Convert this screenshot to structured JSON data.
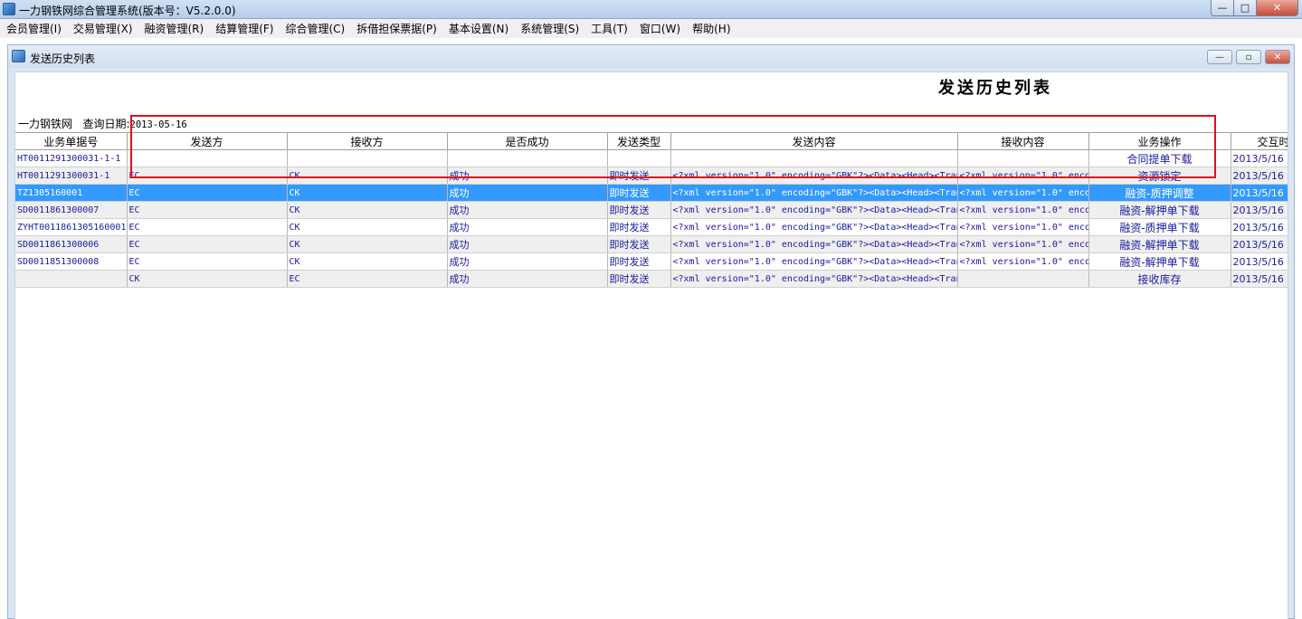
{
  "app": {
    "title": "一力钢铁网综合管理系统(版本号：V5.2.0.0)",
    "window_buttons": {
      "minimize": "—",
      "maximize": "□",
      "close": "✕"
    }
  },
  "menu": [
    "会员管理(I)",
    "交易管理(X)",
    "融资管理(R)",
    "结算管理(F)",
    "综合管理(C)",
    "拆借担保票据(P)",
    "基本设置(N)",
    "系统管理(S)",
    "工具(T)",
    "窗口(W)",
    "帮助(H)"
  ],
  "child_window": {
    "title": "发送历史列表",
    "buttons": {
      "minimize": "—",
      "restore": "▫",
      "close": "✕"
    }
  },
  "report": {
    "title": "发送历史列表",
    "company": "一力钢铁网",
    "date_label": "查询日期:",
    "date_value": "2013-05-16"
  },
  "table": {
    "columns": [
      "业务单据号",
      "发送方",
      "接收方",
      "是否成功",
      "发送类型",
      "发送内容",
      "接收内容",
      "业务操作",
      "交互时"
    ],
    "rows": [
      [
        "HT0011291300031-1-1",
        "",
        "",
        "",
        "",
        "",
        "",
        "合同提单下载",
        "2013/5/16"
      ],
      [
        "HT0011291300031-1",
        "EC",
        "CK",
        "成功",
        "即时发送",
        "<?xml version=\"1.0\" encoding=\"GBK\"?><Data><Head><Tran",
        "<?xml version=\"1.0\" enco",
        "资源锁定",
        "2013/5/16"
      ],
      [
        "TZ1305160001",
        "EC",
        "CK",
        "成功",
        "即时发送",
        "<?xml version=\"1.0\" encoding=\"GBK\"?><Data><Head><Tran",
        "<?xml version=\"1.0\" enco",
        "融资-质押调整",
        "2013/5/16"
      ],
      [
        "SD0011861300007",
        "EC",
        "CK",
        "成功",
        "即时发送",
        "<?xml version=\"1.0\" encoding=\"GBK\"?><Data><Head><Tran",
        "<?xml version=\"1.0\" enco",
        "融资-解押单下载",
        "2013/5/16"
      ],
      [
        "ZYHT0011861305160001",
        "EC",
        "CK",
        "成功",
        "即时发送",
        "<?xml version=\"1.0\" encoding=\"GBK\"?><Data><Head><Tran",
        "<?xml version=\"1.0\" enco",
        "融资-质押单下载",
        "2013/5/16"
      ],
      [
        "SD0011861300006",
        "EC",
        "CK",
        "成功",
        "即时发送",
        "<?xml version=\"1.0\" encoding=\"GBK\"?><Data><Head><Tran",
        "<?xml version=\"1.0\" enco",
        "融资-解押单下载",
        "2013/5/16"
      ],
      [
        "SD0011851300008",
        "EC",
        "CK",
        "成功",
        "即时发送",
        "<?xml version=\"1.0\" encoding=\"GBK\"?><Data><Head><Tran",
        "<?xml version=\"1.0\" enco",
        "融资-解押单下载",
        "2013/5/16"
      ],
      [
        "",
        "CK",
        "EC",
        "成功",
        "即时发送",
        "<?xml version=\"1.0\" encoding=\"GBK\"?><Data><Head><Tran",
        "",
        "接收库存",
        "2013/5/16"
      ]
    ],
    "selected_row": 2
  },
  "colors": {
    "selection": "#3399ff",
    "highlight_box": "#e0101a",
    "cell_text": "#1a1aa0"
  }
}
